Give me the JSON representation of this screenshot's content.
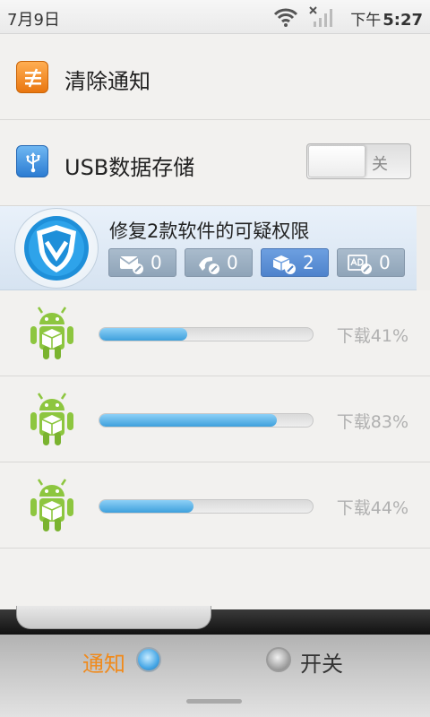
{
  "status_bar": {
    "date": "7月9日",
    "time_period": "下午",
    "time": "5:27",
    "icons": [
      "wifi-icon",
      "no-signal-icon"
    ]
  },
  "clear_notification": {
    "label": "清除通知",
    "icon": "clear-notifications-icon",
    "icon_color": "#f08a1c"
  },
  "usb_storage": {
    "label": "USB数据存储",
    "icon": "usb-icon",
    "toggle_state": "关"
  },
  "security_notice": {
    "icon": "shield-logo-icon",
    "title": "修复2款软件的可疑权限",
    "items": [
      {
        "icon": "sms-permission-icon",
        "count": "0"
      },
      {
        "icon": "call-permission-icon",
        "count": "0"
      },
      {
        "icon": "package-permission-icon",
        "count": "2"
      },
      {
        "icon": "ad-permission-icon",
        "count": "0"
      }
    ]
  },
  "downloads": [
    {
      "icon": "android-package-icon",
      "status": "下载41%",
      "progress": 0.41
    },
    {
      "icon": "android-package-icon",
      "status": "下载83%",
      "progress": 0.83
    },
    {
      "icon": "android-package-icon",
      "status": "下载44%",
      "progress": 0.44
    }
  ],
  "bottom_tabs": {
    "notify": "通知",
    "switches": "开关",
    "active": "notify",
    "accent_color": "#f08a1c"
  }
}
